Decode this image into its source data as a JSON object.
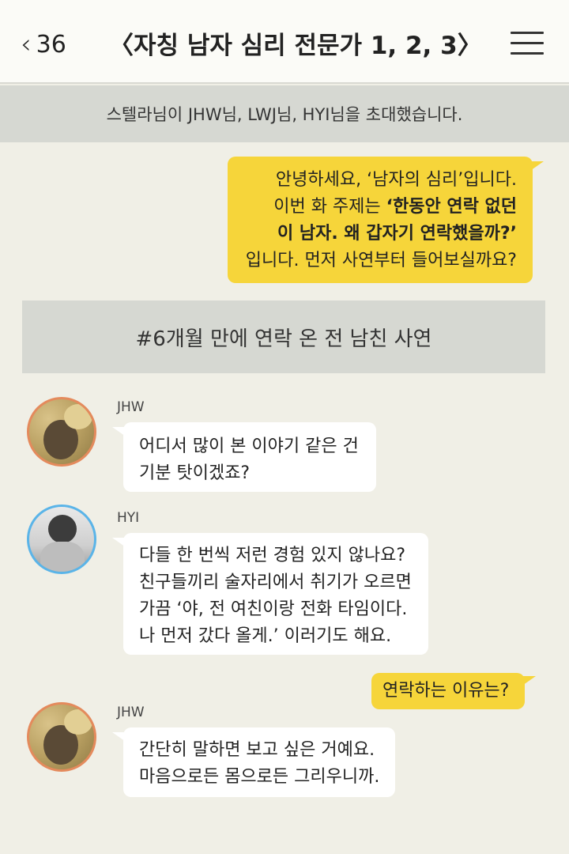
{
  "header": {
    "back_icon": "chevron-left-icon",
    "back_count": "36",
    "title": "〈자칭 남자 심리 전문가 1, 2, 3〉",
    "menu_icon": "hamburger-menu-icon"
  },
  "system_message": "스텔라님이 JHW님, LWJ님, HYI님을 초대했습니다.",
  "intro_bubble": {
    "line1": "안녕하세요, ‘남자의 심리’입니다.",
    "line2_plain": "이번 화 주제는 ",
    "line2_bold": "‘한동안 연락 없던",
    "line3_bold": "이 남자. 왜 갑자기 연락했을까?’",
    "line4": "입니다. 먼저 사연부터 들어보실까요?"
  },
  "topic_banner": "#6개월 만에 연락 온 전 남친 사연",
  "messages": [
    {
      "sender": "JHW",
      "lines": [
        "어디서 많이 본 이야기 같은 건",
        "기분 탓이겠죠?"
      ]
    },
    {
      "sender": "HYI",
      "lines": [
        "다들 한 번씩 저런 경험 있지 않나요?",
        "친구들끼리 술자리에서 취기가 오르면",
        "가끔 ‘야, 전 여친이랑 전화 타임이다.",
        "나 먼저 갔다 올게.’ 이러기도 해요."
      ]
    },
    {
      "sender": "me",
      "lines": [
        "연락하는 이유는?"
      ]
    },
    {
      "sender": "JHW",
      "lines": [
        "간단히 말하면 보고 싶은 거예요.",
        "마음으로든 몸으로든 그리우니까."
      ]
    }
  ],
  "colors": {
    "background": "#f0efe6",
    "my_bubble": "#f6d53a",
    "their_bubble": "#ffffff",
    "banner": "#d6d8d2",
    "jhw_avatar_ring": "#e48a5c",
    "hyi_avatar_ring": "#5ab4e8"
  }
}
